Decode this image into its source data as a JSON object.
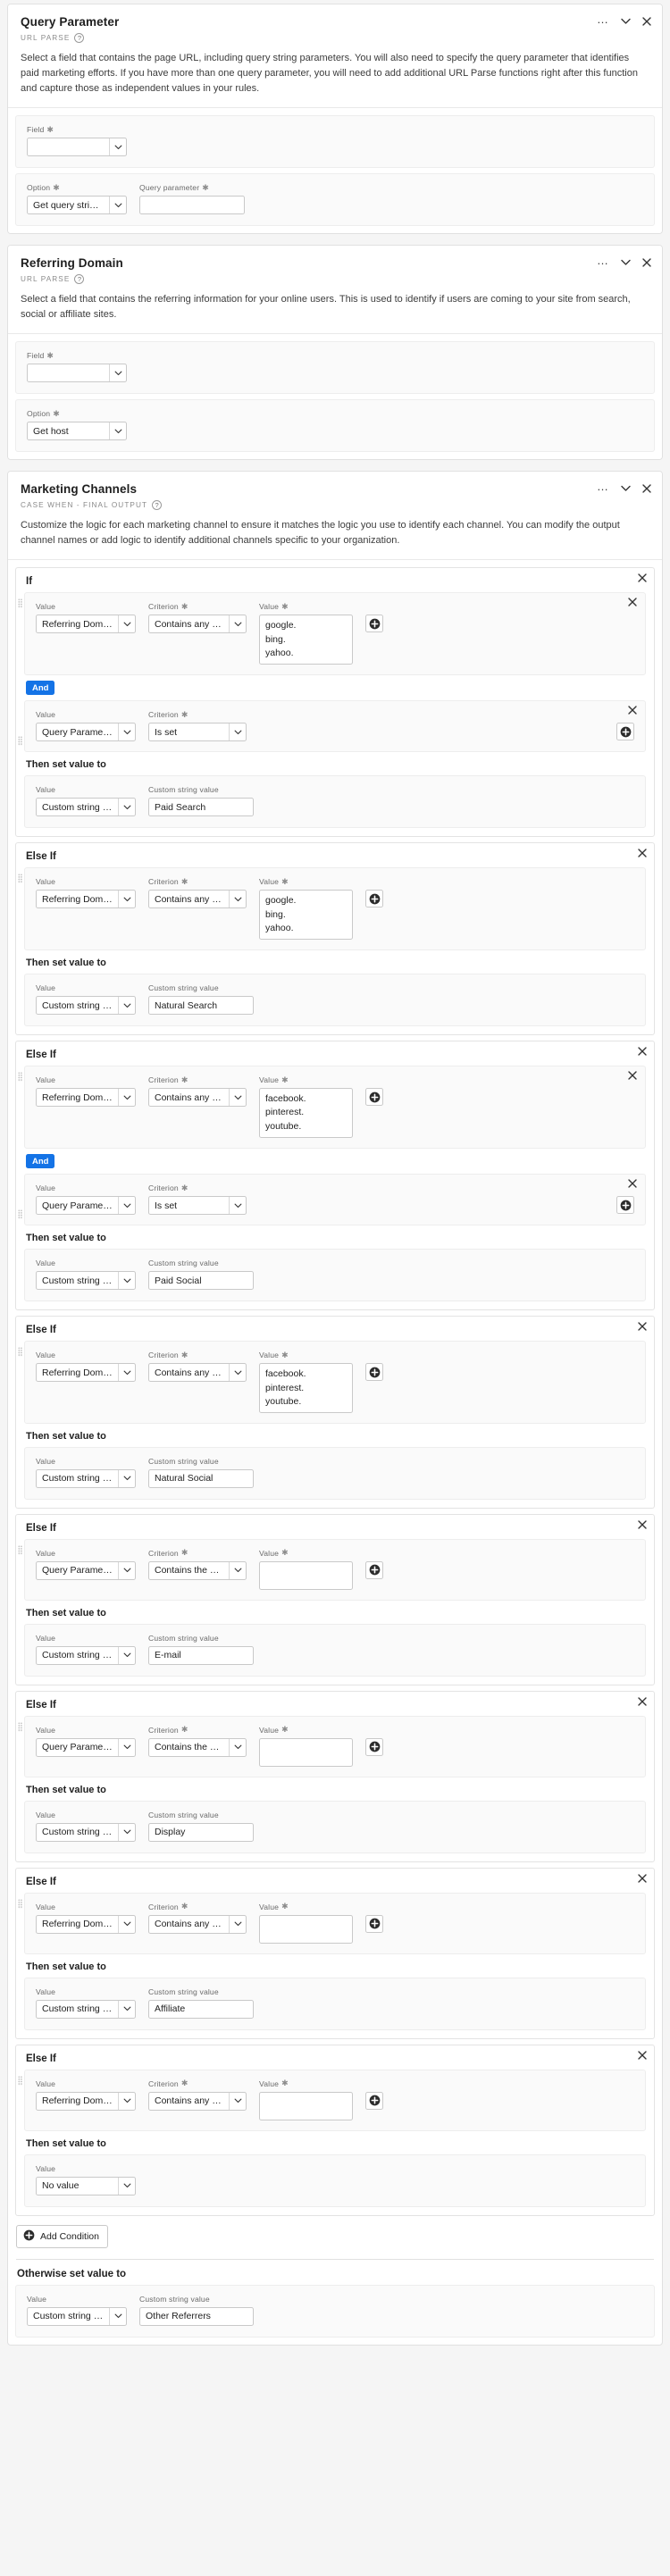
{
  "cards": [
    {
      "title": "Query Parameter",
      "kind": "URL PARSE",
      "description": "Select a field that contains the page URL, including query string parameters. You will also need to specify the query parameter that identifies paid marketing efforts. If you have more than one query parameter, you will need to add additional URL Parse functions right after this function and capture those as independent values in your rules.",
      "field_label": "Field",
      "field_value": "",
      "option_label": "Option",
      "option_value": "Get query string value",
      "param_label": "Query parameter",
      "param_value": ""
    },
    {
      "title": "Referring Domain",
      "kind": "URL PARSE",
      "description": "Select a field that contains the referring information for your online users. This is used to identify if users are coming to your site from search, social or affiliate sites.",
      "field_label": "Field",
      "field_value": "",
      "option_label": "Option",
      "option_value": "Get host"
    }
  ],
  "marketing": {
    "title": "Marketing Channels",
    "kind": "CASE WHEN - FINAL OUTPUT",
    "description": "Customize the logic for each marketing channel to ensure it matches the logic you use to identify each channel. You can modify the output channel names or add logic to identify additional channels specific to your organization.",
    "labels": {
      "value": "Value",
      "criterion": "Criterion",
      "custom_string": "Custom string value",
      "then": "Then set value to",
      "and": "And",
      "add_condition": "Add Condition",
      "otherwise": "Otherwise set value to"
    },
    "conditions": [
      {
        "header": "If",
        "criteria": [
          {
            "value": "Referring Domain",
            "criterion": "Contains any term",
            "terms": [
              "google.",
              "bing.",
              "yahoo."
            ],
            "show_value": true,
            "show_x": true
          },
          {
            "value": "Query Parameter",
            "criterion": "Is set",
            "terms": [],
            "show_value": false,
            "show_x": true
          }
        ],
        "joiner": "And",
        "then": {
          "value": "Custom string value",
          "custom": "Paid Search"
        }
      },
      {
        "header": "Else If",
        "criteria": [
          {
            "value": "Referring Domain",
            "criterion": "Contains any term",
            "terms": [
              "google.",
              "bing.",
              "yahoo."
            ],
            "show_value": true,
            "show_x": false
          }
        ],
        "joiner": null,
        "then": {
          "value": "Custom string value",
          "custom": "Natural Search"
        }
      },
      {
        "header": "Else If",
        "criteria": [
          {
            "value": "Referring Domain",
            "criterion": "Contains any term",
            "terms": [
              "facebook.",
              "pinterest.",
              "youtube."
            ],
            "show_value": true,
            "show_x": true
          },
          {
            "value": "Query Parameter",
            "criterion": "Is set",
            "terms": [],
            "show_value": false,
            "show_x": true
          }
        ],
        "joiner": "And",
        "then": {
          "value": "Custom string value",
          "custom": "Paid Social"
        }
      },
      {
        "header": "Else If",
        "criteria": [
          {
            "value": "Referring Domain",
            "criterion": "Contains any term",
            "terms": [
              "facebook.",
              "pinterest.",
              "youtube."
            ],
            "show_value": true,
            "show_x": false
          }
        ],
        "joiner": null,
        "then": {
          "value": "Custom string value",
          "custom": "Natural Social"
        }
      },
      {
        "header": "Else If",
        "criteria": [
          {
            "value": "Query Parameter",
            "criterion": "Contains the phrase",
            "terms": [],
            "show_value": true,
            "show_x": false
          }
        ],
        "joiner": null,
        "then": {
          "value": "Custom string value",
          "custom": "E-mail"
        }
      },
      {
        "header": "Else If",
        "criteria": [
          {
            "value": "Query Parameter",
            "criterion": "Contains the phrase",
            "terms": [],
            "show_value": true,
            "show_x": false
          }
        ],
        "joiner": null,
        "then": {
          "value": "Custom string value",
          "custom": "Display"
        }
      },
      {
        "header": "Else If",
        "criteria": [
          {
            "value": "Referring Domain",
            "criterion": "Contains any term",
            "terms": [],
            "show_value": true,
            "show_x": false
          }
        ],
        "joiner": null,
        "then": {
          "value": "Custom string value",
          "custom": "Affiliate"
        }
      },
      {
        "header": "Else If",
        "criteria": [
          {
            "value": "Referring Domain",
            "criterion": "Contains any term",
            "terms": [],
            "show_value": true,
            "show_x": false
          }
        ],
        "joiner": null,
        "then": {
          "value": "No value",
          "custom": null
        }
      }
    ],
    "otherwise": {
      "value": "Custom string value",
      "custom": "Other Referrers"
    }
  },
  "icons": {
    "more": "…",
    "collapse": "⌄",
    "close": "✕",
    "help": "?"
  },
  "colors": {
    "accent": "#1473e6",
    "card_bg": "#ffffff",
    "page_bg": "#f5f5f5",
    "panel_bg": "#fafafa"
  }
}
